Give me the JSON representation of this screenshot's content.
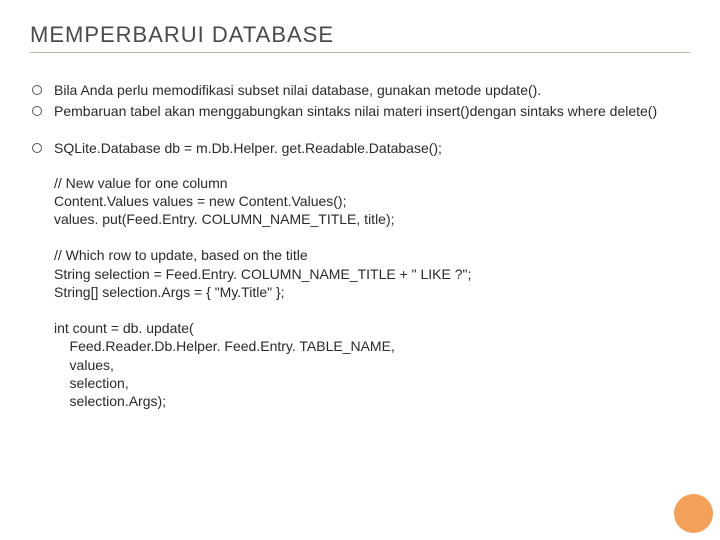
{
  "title": "MEMPERBARUI DATABASE",
  "bullets": [
    "Bila Anda perlu memodifikasi subset nilai database, gunakan metode update().",
    "Pembaruan tabel akan menggabungkan sintaks nilai materi insert()dengan sintaks where delete()"
  ],
  "code_lead": "SQLite.Database db = m.Db.Helper. get.Readable.Database();",
  "code": "// New value for one column\nContent.Values values = new Content.Values();\nvalues. put(Feed.Entry. COLUMN_NAME_TITLE, title);\n\n// Which row to update, based on the title\nString selection = Feed.Entry. COLUMN_NAME_TITLE + \" LIKE ?\";\nString[] selection.Args = { \"My.Title\" };\n\nint count = db. update(\n    Feed.Reader.Db.Helper. Feed.Entry. TABLE_NAME,\n    values,\n    selection,\n    selection.Args);"
}
